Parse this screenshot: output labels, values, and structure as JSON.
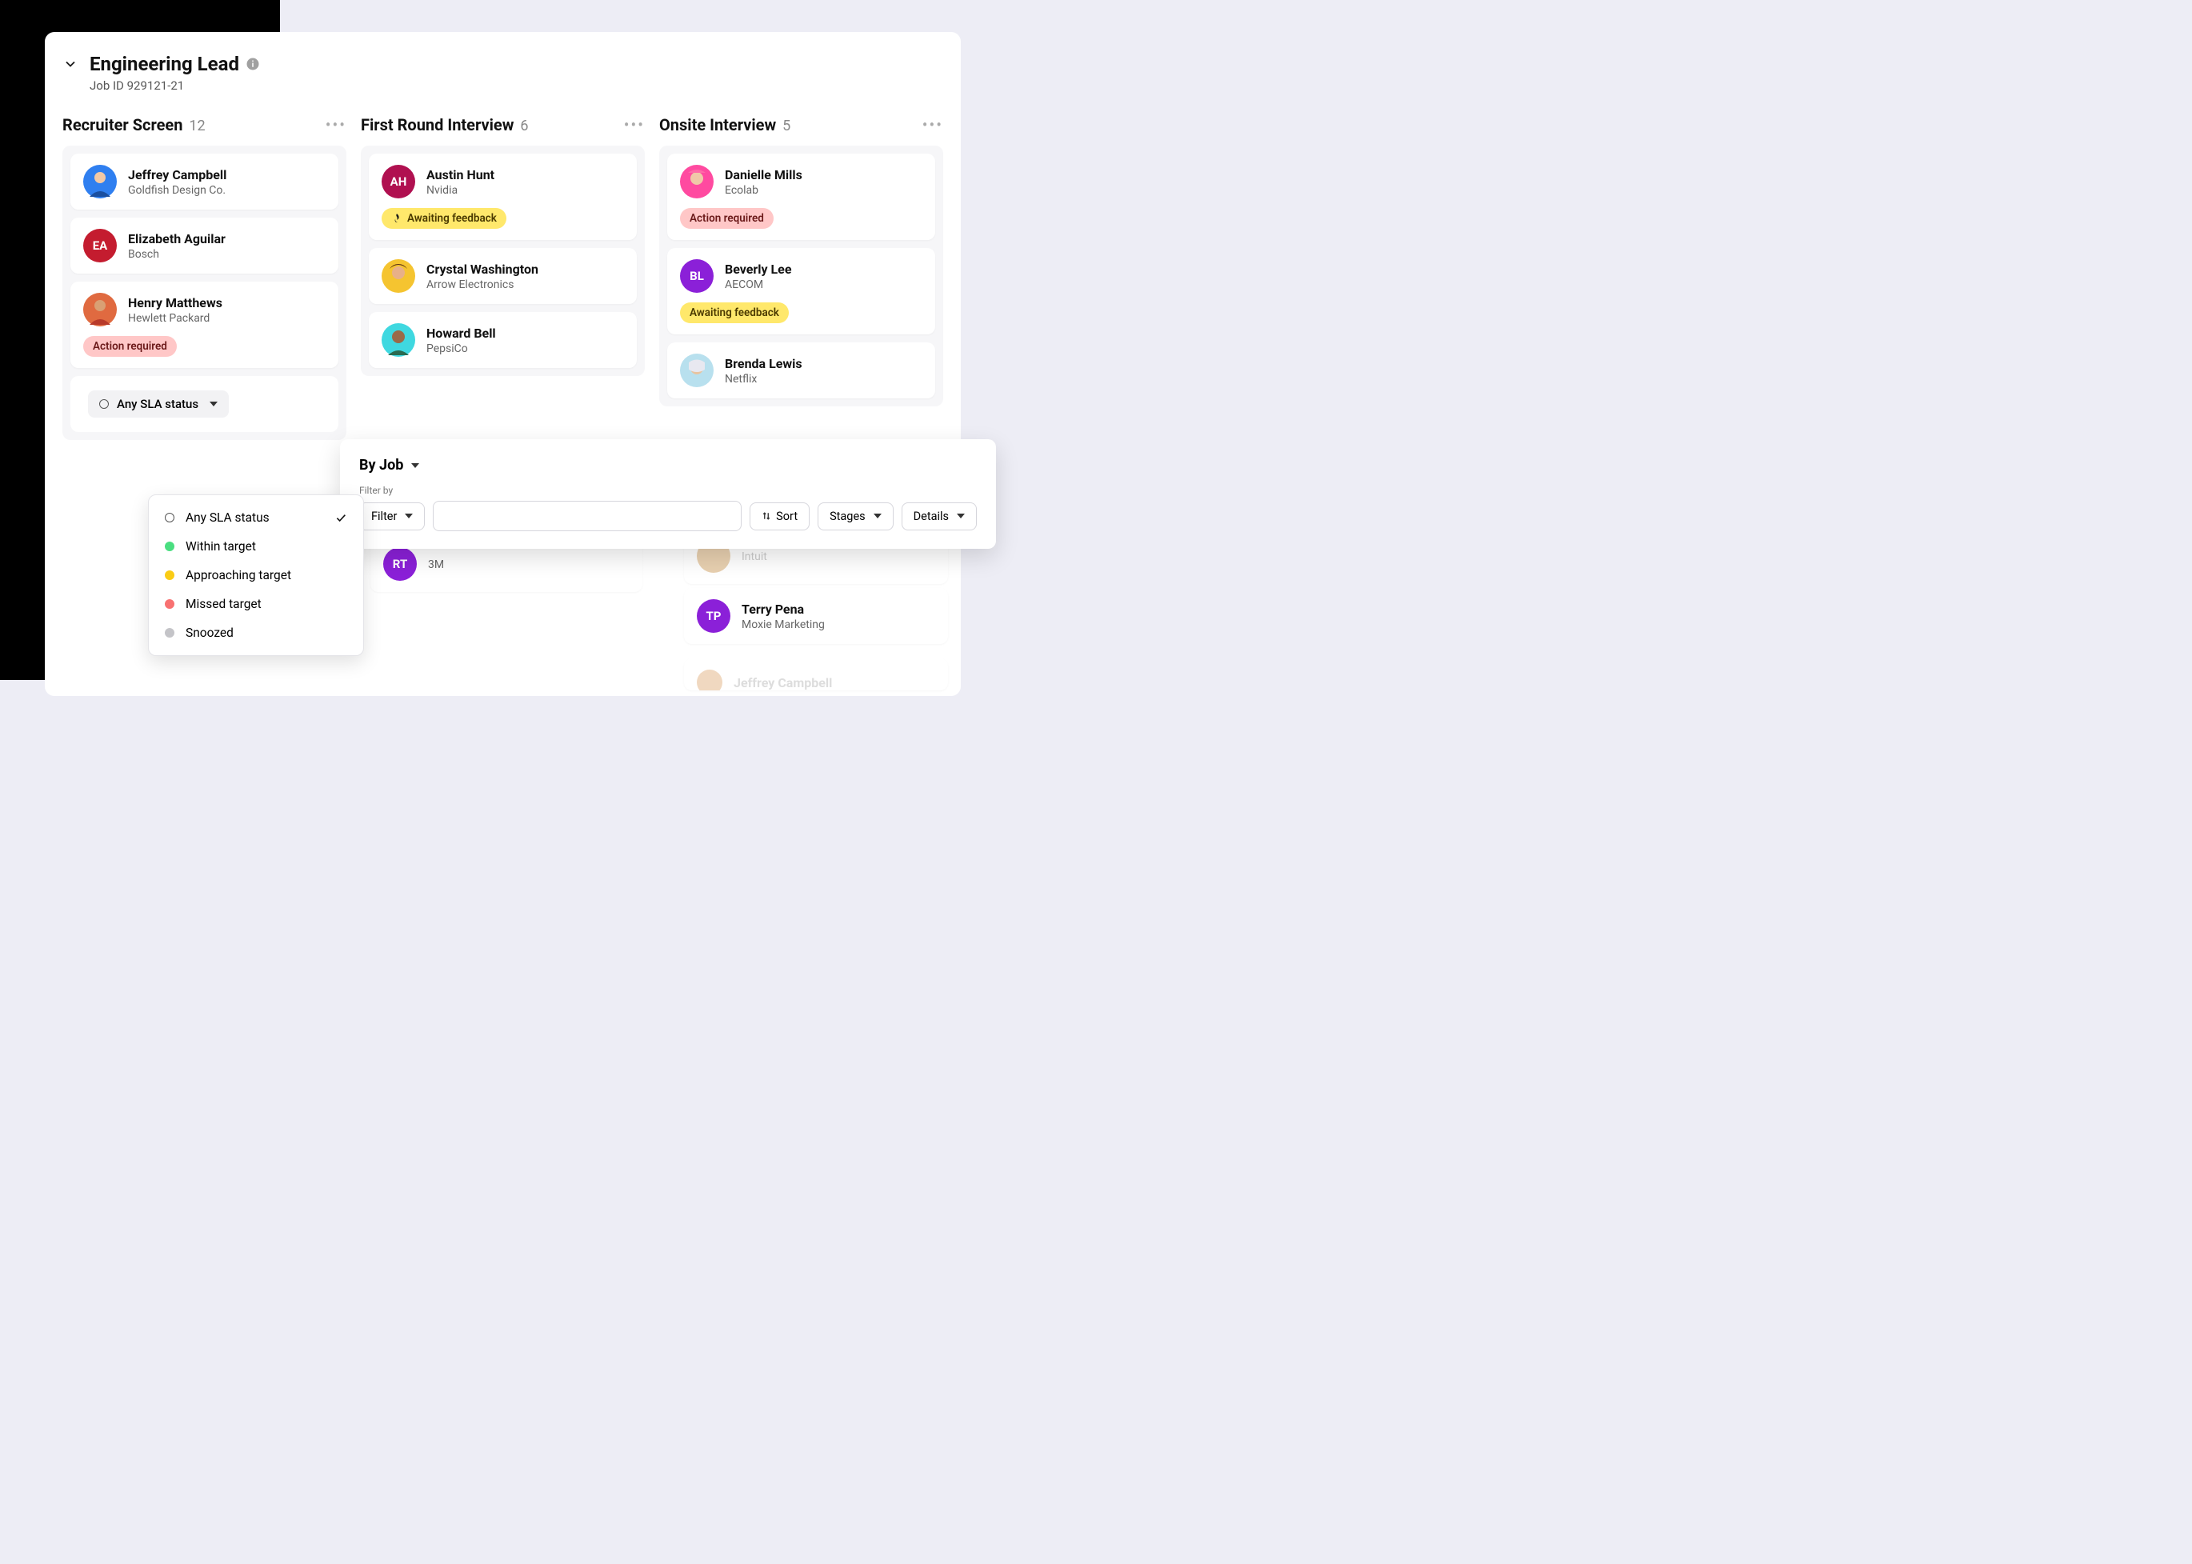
{
  "job": {
    "title": "Engineering Lead",
    "id_label": "Job ID 929121-21"
  },
  "stages": [
    {
      "name": "Recruiter Screen",
      "count": "12",
      "cards": [
        {
          "name": "Jeffrey Campbell",
          "company": "Goldfish Design Co.",
          "avatar_bg": "#2f7ff0",
          "initials": "",
          "badge": null
        },
        {
          "name": "Elizabeth Aguilar",
          "company": "Bosch",
          "avatar_bg": "#c41c2f",
          "initials": "EA",
          "badge": null
        },
        {
          "name": "Henry Matthews",
          "company": "Hewlett Packard",
          "avatar_bg": "#e06a40",
          "initials": "",
          "badge": "action"
        }
      ]
    },
    {
      "name": "First Round Interview",
      "count": "6",
      "cards": [
        {
          "name": "Austin Hunt",
          "company": "Nvidia",
          "avatar_bg": "#b01050",
          "initials": "AH",
          "badge": "await"
        },
        {
          "name": "Crystal Washington",
          "company": "Arrow Electronics",
          "avatar_bg": "#f5c430",
          "initials": "",
          "badge": null
        },
        {
          "name": "Howard Bell",
          "company": "PepsiCo",
          "avatar_bg": "#3fd8e0",
          "initials": "",
          "badge": null
        }
      ]
    },
    {
      "name": "Onsite Interview",
      "count": "5",
      "cards": [
        {
          "name": "Danielle Mills",
          "company": "Ecolab",
          "avatar_bg": "#ff4aa0",
          "initials": "",
          "badge": "action"
        },
        {
          "name": "Beverly Lee",
          "company": "AECOM",
          "avatar_bg": "#8b20d8",
          "initials": "BL",
          "badge": "await"
        },
        {
          "name": "Brenda Lewis",
          "company": "Netflix",
          "avatar_bg": "#b8e0ee",
          "initials": "",
          "badge": null
        }
      ]
    }
  ],
  "badges": {
    "action": "Action required",
    "await": "Awaiting feedback"
  },
  "sla": {
    "trigger": "Any SLA status",
    "options": [
      {
        "label": "Any SLA status",
        "color": "hollow",
        "checked": true
      },
      {
        "label": "Within target",
        "color": "#4ade80",
        "checked": false
      },
      {
        "label": "Approaching target",
        "color": "#facc15",
        "checked": false
      },
      {
        "label": "Missed target",
        "color": "#f87171",
        "checked": false
      },
      {
        "label": "Snoozed",
        "color": "#c4c4c8",
        "checked": false
      }
    ]
  },
  "filter_popover": {
    "heading": "By Job",
    "filter_by_label": "Filter by",
    "filter_btn": "Filter",
    "sort_btn": "Sort",
    "stages_btn": "Stages",
    "details_btn": "Details"
  },
  "peek_cards": {
    "col2_rt": {
      "initials": "RT",
      "company": "3M",
      "avatar_bg": "#8b20d8"
    },
    "col3_intuit": {
      "company": "Intuit"
    },
    "col3_terry": {
      "name": "Terry Pena",
      "company": "Moxie Marketing",
      "initials": "TP",
      "avatar_bg": "#8b20d8"
    },
    "col3_jeffrey": {
      "name": "Jeffrey Campbell"
    }
  }
}
